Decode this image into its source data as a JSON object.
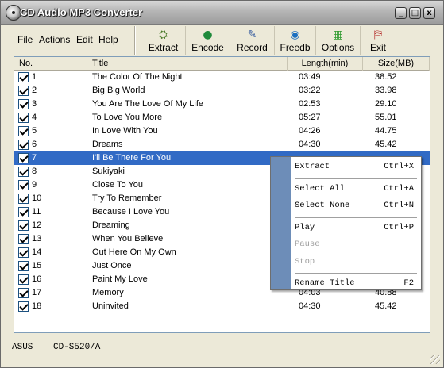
{
  "window": {
    "title": "CD Audio MP3 Converter"
  },
  "title_buttons": {
    "minimize": "_",
    "maximize": "□",
    "close": "x"
  },
  "menu": [
    "File",
    "Actions",
    "Edit",
    "Help"
  ],
  "toolbar": [
    {
      "label": "Extract",
      "icon": "extract-icon"
    },
    {
      "label": "Encode",
      "icon": "encode-icon"
    },
    {
      "label": "Record",
      "icon": "record-icon"
    },
    {
      "label": "Freedb",
      "icon": "freedb-icon"
    },
    {
      "label": "Options",
      "icon": "options-icon"
    },
    {
      "label": "Exit",
      "icon": "exit-icon"
    }
  ],
  "columns": [
    "No.",
    "Title",
    "Length(min)",
    "Size(MB)"
  ],
  "tracks": [
    {
      "no": "1",
      "title": "The Color Of The Night",
      "length": "03:49",
      "size": "38.52",
      "checked": true
    },
    {
      "no": "2",
      "title": "Big Big World",
      "length": "03:22",
      "size": "33.98",
      "checked": true
    },
    {
      "no": "3",
      "title": "You Are The Love Of My Life",
      "length": "02:53",
      "size": "29.10",
      "checked": true
    },
    {
      "no": "4",
      "title": "To Love You More",
      "length": "05:27",
      "size": "55.01",
      "checked": true
    },
    {
      "no": "5",
      "title": "In Love With You",
      "length": "04:26",
      "size": "44.75",
      "checked": true
    },
    {
      "no": "6",
      "title": "Dreams",
      "length": "04:30",
      "size": "45.42",
      "checked": true
    },
    {
      "no": "7",
      "title": "I'll Be There For You",
      "length": "",
      "size": "",
      "checked": true,
      "selected": true
    },
    {
      "no": "8",
      "title": "Sukiyaki",
      "length": "",
      "size": "",
      "checked": true
    },
    {
      "no": "9",
      "title": "Close To You",
      "length": "",
      "size": "",
      "checked": true
    },
    {
      "no": "10",
      "title": "Try To Remember",
      "length": "",
      "size": "",
      "checked": true
    },
    {
      "no": "11",
      "title": "Because I Love You",
      "length": "",
      "size": "",
      "checked": true
    },
    {
      "no": "12",
      "title": "Dreaming",
      "length": "",
      "size": "",
      "checked": true
    },
    {
      "no": "13",
      "title": "When You Believe",
      "length": "",
      "size": "",
      "checked": true
    },
    {
      "no": "14",
      "title": "Out Here On My Own",
      "length": "",
      "size": "",
      "checked": true
    },
    {
      "no": "15",
      "title": "Just Once",
      "length": "",
      "size": "",
      "checked": true
    },
    {
      "no": "16",
      "title": "Paint My Love",
      "length": "",
      "size": "",
      "checked": true
    },
    {
      "no": "17",
      "title": "Memory",
      "length": "04:03",
      "size": "40.88",
      "checked": true
    },
    {
      "no": "18",
      "title": "Uninvited",
      "length": "04:30",
      "size": "45.42",
      "checked": true
    }
  ],
  "context_menu": [
    {
      "label": "Extract",
      "shortcut": "Ctrl+X",
      "enabled": true
    },
    {
      "separator": true
    },
    {
      "label": "Select All",
      "shortcut": "Ctrl+A",
      "enabled": true
    },
    {
      "label": "Select None",
      "shortcut": "Ctrl+N",
      "enabled": true
    },
    {
      "separator": true
    },
    {
      "label": "Play",
      "shortcut": "Ctrl+P",
      "enabled": true
    },
    {
      "label": "Pause",
      "shortcut": "",
      "enabled": false
    },
    {
      "label": "Stop",
      "shortcut": "",
      "enabled": false
    },
    {
      "separator": true
    },
    {
      "label": "Rename Title",
      "shortcut": "F2",
      "enabled": true
    }
  ],
  "status": {
    "drive_vendor": "ASUS",
    "drive_model": "CD-S520/A"
  },
  "colors": {
    "selection": "#316ac5",
    "menu_sidebar": "#6d8db8",
    "window_bg": "#ece9d8"
  }
}
